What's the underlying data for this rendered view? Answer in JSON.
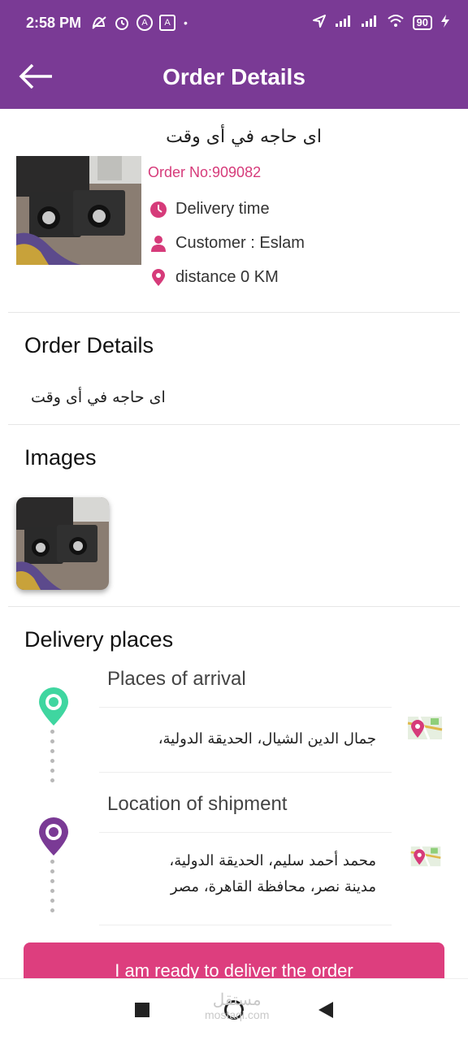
{
  "status_bar": {
    "time": "2:58 PM",
    "battery": "90",
    "icons": [
      "mute-icon",
      "alarm-icon",
      "app-icon-a",
      "app-icon-a-boxed",
      "location-arrow-icon",
      "signal-icon",
      "signal-icon",
      "wifi-icon",
      "battery-icon",
      "charging-icon"
    ]
  },
  "appbar": {
    "title": "Order Details",
    "back_icon": "arrow-left-icon"
  },
  "order": {
    "product_title": "ای حاجه في أى وقت",
    "order_no": "Order No:909082",
    "delivery_time_label": "Delivery time",
    "customer_label": "Customer : Eslam",
    "distance_label": "distance 0 KM"
  },
  "details_section": {
    "title": "Order Details",
    "description": "ای حاجه في أى وقت"
  },
  "images_section": {
    "title": "Images"
  },
  "delivery_section": {
    "title": "Delivery places",
    "arrival": {
      "label": "Places of arrival",
      "address": "جمال الدين الشيال، الحديقة الدولية،"
    },
    "shipment": {
      "label": "Location of shipment",
      "address_line1": "محمد أحمد سليم، الحديقة الدولية،",
      "address_line2": "مدينة نصر، محافظة القاهرة، مصر"
    }
  },
  "cta": {
    "label": "I am ready to deliver the order"
  },
  "watermark": {
    "line1": "مستقل",
    "line2": "mostaql.com"
  },
  "colors": {
    "primary": "#7a3a95",
    "accent": "#dd3e7e",
    "arrival_pin": "#3fd6a0",
    "shipment_pin": "#7a3a95"
  }
}
